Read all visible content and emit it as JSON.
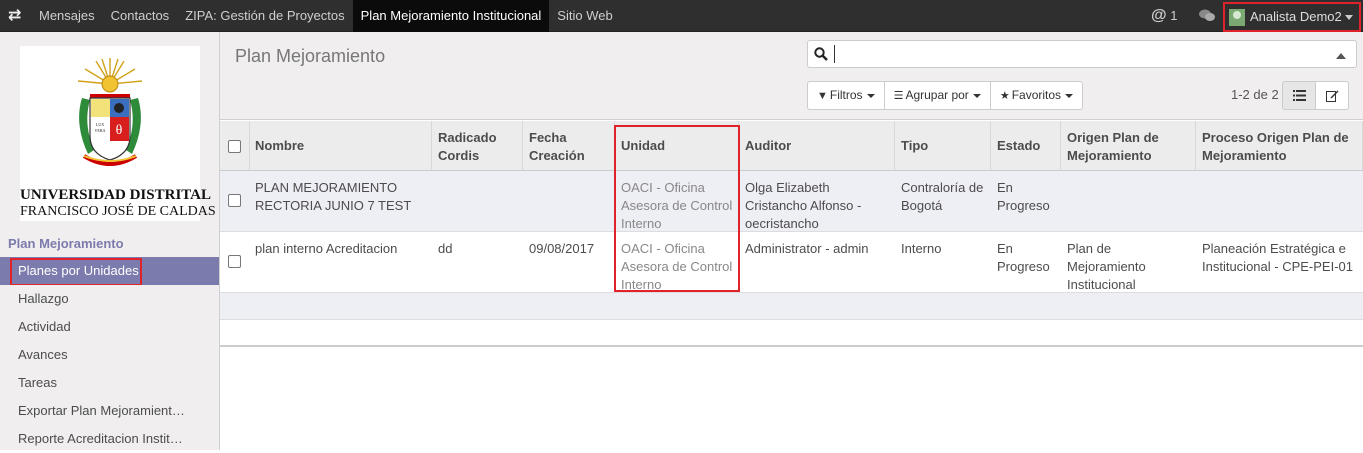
{
  "topbar": {
    "menu": [
      "Mensajes",
      "Contactos",
      "ZIPA: Gestión de Proyectos",
      "Plan Mejoramiento Institucional",
      "Sitio Web"
    ],
    "active_index": 3,
    "mentions_count": "1",
    "user_name": "Analista Demo2"
  },
  "sidebar": {
    "logo_line1": "UNIVERSIDAD DISTRITAL",
    "logo_line2": "FRANCISCO JOSÉ DE CALDAS",
    "section_title": "Plan Mejoramiento",
    "items": [
      "Planes por Unidades",
      "Hallazgo",
      "Actividad",
      "Avances",
      "Tareas",
      "Exportar Plan Mejoramient…",
      "Reporte Acreditacion Instit…"
    ]
  },
  "main": {
    "title": "Plan Mejoramiento",
    "search_placeholder": "",
    "filters_label": "Filtros",
    "group_label": "Agrupar por",
    "favorites_label": "Favoritos",
    "pager": "1-2 de 2",
    "columns": [
      "Nombre",
      "Radicado Cordis",
      "Fecha Creación",
      "Unidad",
      "Auditor",
      "Tipo",
      "Estado",
      "Origen Plan de Mejoramiento",
      "Proceso Origen Plan de Mejoramiento"
    ],
    "rows": [
      {
        "nombre": "PLAN MEJORAMIENTO RECTORIA JUNIO 7 TEST",
        "radicado": "",
        "fecha": "",
        "unidad": "OACI - Oficina Asesora de Control Interno",
        "auditor": "Olga Elizabeth Cristancho Alfonso - oecristancho",
        "tipo": "Contraloría de Bogotá",
        "estado": "En Progreso",
        "origen": "",
        "proceso": ""
      },
      {
        "nombre": "plan interno Acreditacion",
        "radicado": "dd",
        "fecha": "09/08/2017",
        "unidad": "OACI - Oficina Asesora de Control Interno",
        "auditor": "Administrator - admin",
        "tipo": "Interno",
        "estado": "En Progreso",
        "origen": "Plan de Mejoramiento Institucional",
        "proceso": "Planeación Estratégica e Institucional - CPE-PEI-01"
      }
    ]
  }
}
